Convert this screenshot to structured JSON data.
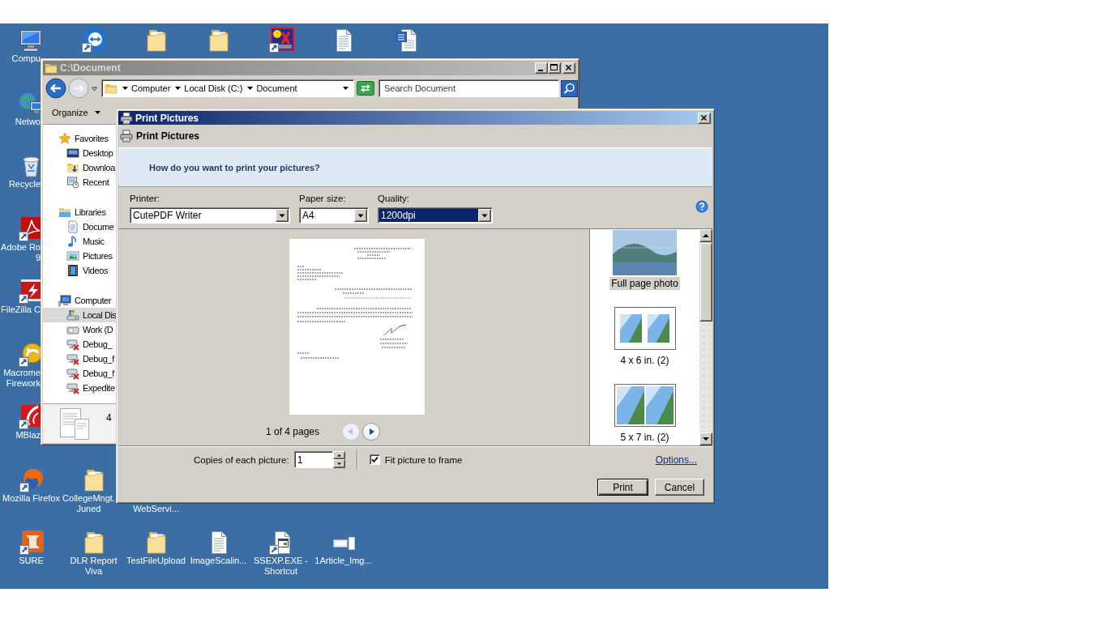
{
  "desktop": {
    "icons": [
      {
        "kind": "computer",
        "label": "Compu"
      },
      {
        "kind": "remote_app"
      },
      {
        "kind": "folder"
      },
      {
        "kind": "folder"
      },
      {
        "kind": "paint_app"
      },
      {
        "kind": "text_file"
      },
      {
        "kind": "word_doc"
      },
      {
        "kind": "network",
        "label": "Netwo"
      },
      {
        "kind": "recycle_bin",
        "label": "Recycle"
      },
      {
        "kind": "pdf_app",
        "label": "Adobe Ro\n9"
      },
      {
        "kind": "ftp_app",
        "label": "FileZilla C"
      },
      {
        "kind": "graphics_app",
        "label": "Macrome\nFirework"
      },
      {
        "kind": "media_app",
        "label": "MBlaz"
      },
      {
        "kind": "browser",
        "label": "Mozilla Firefox"
      },
      {
        "kind": "folder",
        "label": "CollegeMngt.\nJuned"
      },
      {
        "kind": "covered",
        "label": "WebServi..."
      },
      {
        "kind": "tool_app",
        "label": "SURE"
      },
      {
        "kind": "folder",
        "label": "DLR Report Viva"
      },
      {
        "kind": "folder",
        "label": "TestFileUpload"
      },
      {
        "kind": "text_file",
        "label": "ImageScalin..."
      },
      {
        "kind": "exe_shortcut",
        "label": "SSEXP.EXE - Shortcut"
      },
      {
        "kind": "image_file",
        "label": "1Article_Img..."
      }
    ]
  },
  "explorer_window": {
    "title": "C:\\Document",
    "nav_buttons": [
      {
        "kind": "back",
        "disabled": false
      },
      {
        "kind": "forward",
        "disabled": true
      }
    ],
    "address_bar": {
      "breadcrumbs": [
        "Computer",
        "Local Disk (C:)",
        "Document"
      ]
    },
    "search": {
      "placeholder": "Search Document"
    },
    "toolbar": {
      "organize_button": "Organize"
    },
    "nav_pane": {
      "items": [
        {
          "label": "Favorites",
          "kind": "favorites",
          "selected": false,
          "children": [
            {
              "label": "Desktop",
              "kind": "desktop",
              "selected": false
            },
            {
              "label": "Downloa",
              "kind": "downloads",
              "selected": false
            },
            {
              "label": "Recent",
              "kind": "recent",
              "selected": false
            }
          ]
        },
        {
          "label": "Libraries",
          "kind": "libraries",
          "selected": false,
          "children": [
            {
              "label": "Docume",
              "kind": "documents",
              "selected": false
            },
            {
              "label": "Music",
              "kind": "music",
              "selected": false
            },
            {
              "label": "Pictures",
              "kind": "pictures",
              "selected": false
            },
            {
              "label": "Videos",
              "kind": "videos",
              "selected": false
            }
          ]
        },
        {
          "label": "Computer",
          "kind": "computer",
          "selected": false,
          "children": [
            {
              "label": "Local Dis",
              "kind": "system_drive",
              "selected": true
            },
            {
              "label": "Work (D",
              "kind": "drive",
              "selected": false
            },
            {
              "label": "Debug_",
              "kind": "network_drive",
              "selected": false
            },
            {
              "label": "Debug_f",
              "kind": "network_drive",
              "selected": false
            },
            {
              "label": "Debug_f",
              "kind": "network_drive",
              "selected": false
            },
            {
              "label": "Expedite",
              "kind": "network_drive",
              "selected": false
            }
          ]
        }
      ]
    },
    "details_pane": {
      "count": "4"
    }
  },
  "print_dialog": {
    "title": "Print Pictures",
    "heading": "Print Pictures",
    "prompt": "How do you want to print your pictures?",
    "options": [
      {
        "label": "Printer:",
        "value": "CutePDF Writer",
        "focused": false
      },
      {
        "label": "Paper size:",
        "value": "A4",
        "focused": false
      },
      {
        "label": "Quality:",
        "value": "1200dpi",
        "focused": true
      }
    ],
    "preview": {
      "page_status": "1 of 4 pages",
      "nav_buttons": [
        {
          "kind": "previous",
          "disabled": true
        },
        {
          "kind": "next",
          "disabled": false
        }
      ]
    },
    "layouts": [
      {
        "label": "Full page photo",
        "kind": "full_page",
        "selected": true
      },
      {
        "label": "4 x 6 in. (2)",
        "kind": "two_small",
        "selected": false
      },
      {
        "label": "5 x 7 in. (2)",
        "kind": "two_large",
        "selected": false
      }
    ],
    "copies": {
      "label": "Copies of each picture:",
      "value": "1"
    },
    "fit_to_frame": {
      "label": "Fit picture to frame",
      "checked": true
    },
    "options_link": "Options...",
    "buttons": [
      {
        "label": "Print",
        "default": true
      },
      {
        "label": "Cancel",
        "default": false
      }
    ]
  }
}
